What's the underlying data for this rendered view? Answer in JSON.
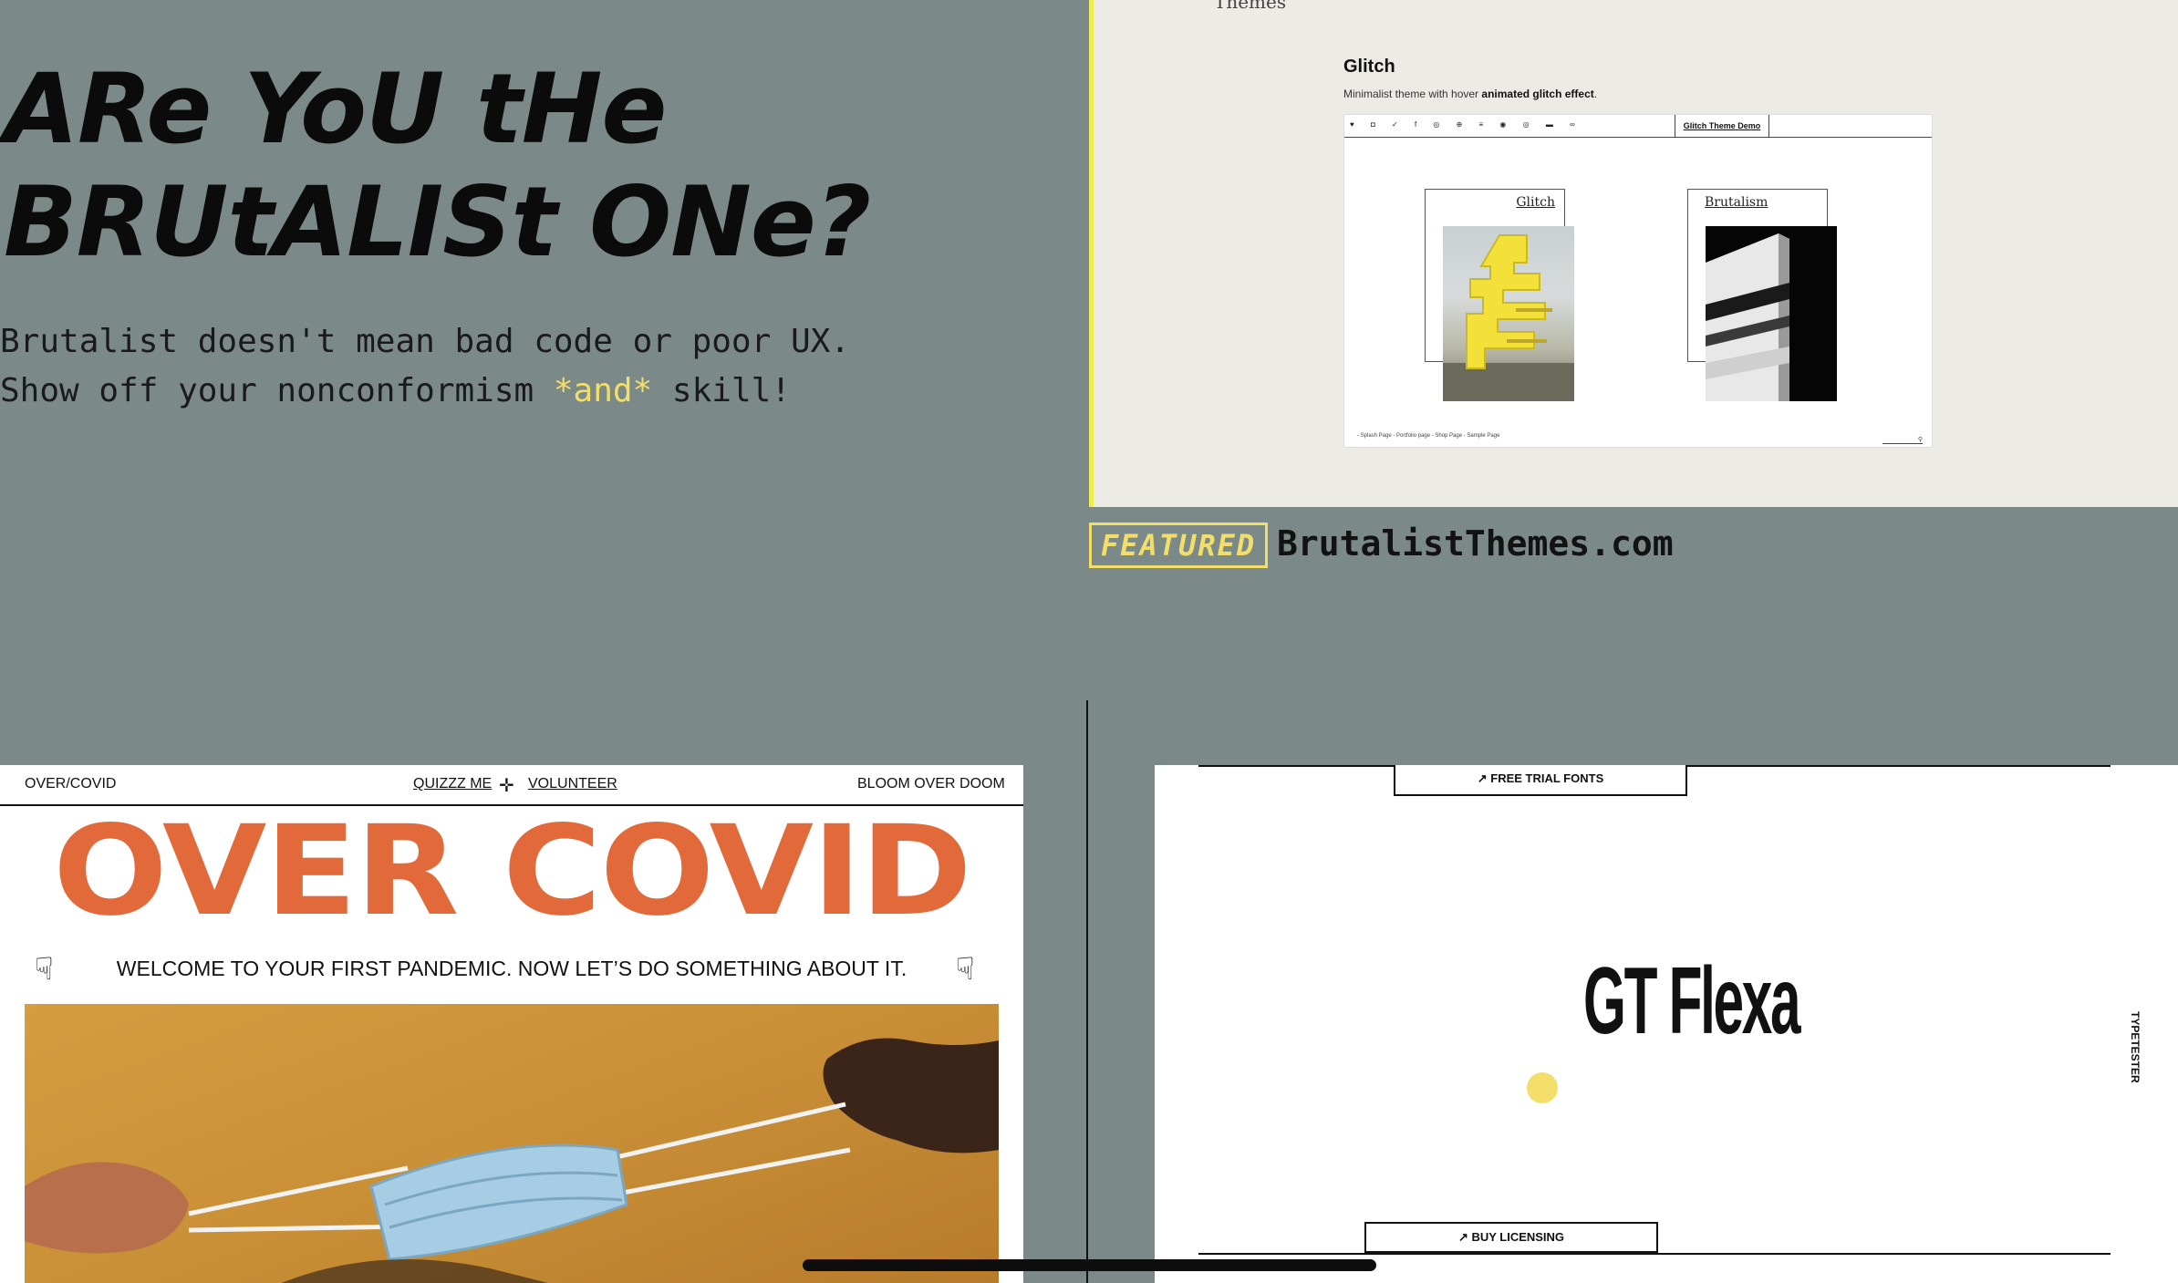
{
  "hero": {
    "title_line1": "ARe YoU tHe",
    "title_line2": "BRUtALISt ONe?",
    "body_line1": "Brutalist doesn't mean bad code or poor UX.",
    "body_line2_before": "Show off your nonconformism ",
    "body_line2_highlight": "*and*",
    "body_line2_after": " skill!"
  },
  "featured_card": {
    "breadcrumb": "Themes",
    "theme_title": "Glitch",
    "description_before": "Minimalist theme with hover ",
    "description_bold": "animated glitch effect",
    "description_after": ".",
    "preview": {
      "toolbar_icons": "♥ ◘ ✓ f ◎ ⊕ ≡ ◉ ◎ ▬ ∞",
      "demo_tab": "Glitch Theme Demo",
      "cards": [
        {
          "label": "Glitch"
        },
        {
          "label": "Brutalism"
        }
      ],
      "footer_links": "- Splash Page   - Portfolio page   - Shop Page   - Sample Page",
      "search_glyph": "⚲"
    },
    "badge": "FEATURED",
    "site": "BrutalistThemes.com"
  },
  "covid": {
    "nav_brand": "OVER/COVID",
    "nav_quiz": "QUIZZZ ME",
    "nav_separator": "✛",
    "nav_volunteer": "VOLUNTEER",
    "nav_right": "BLOOM OVER DOOM",
    "title": "OVER COVID",
    "welcome": "WELCOME TO YOUR FIRST PANDEMIC. NOW LET’S DO SOMETHING ABOUT IT.",
    "hand_glyph": "☟"
  },
  "flexa": {
    "trial_button": "↗ FREE TRIAL FONTS",
    "title": "GT Flexa",
    "buy_button": "↗ BUY LICENSING",
    "side_label": "TYPETESTER"
  },
  "colors": {
    "background": "#7b8a89",
    "accent_yellow": "#f4de6a",
    "covid_orange": "#e26a3a"
  }
}
